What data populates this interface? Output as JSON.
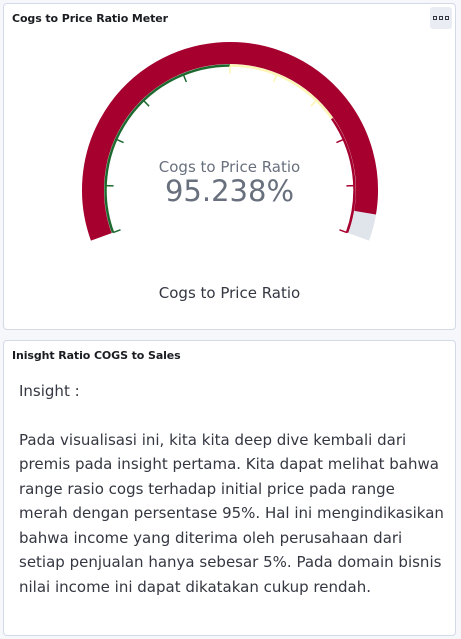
{
  "gauge_panel": {
    "title": "Cogs to Price Ratio Meter",
    "metric_label": "Cogs to Price Ratio",
    "metric_value": "95.238%",
    "caption": "Cogs to Price Ratio",
    "value_percent": 95.238,
    "colors": {
      "fill": "#a6002f",
      "track": "#e0e4eb",
      "green_band": "#1d6a2f",
      "yellow_band": "#fdf5b3",
      "red_band": "#a6002f"
    }
  },
  "insight_panel": {
    "title": "Inisght Ratio COGS to Sales",
    "heading": "Insight :",
    "paragraph": "Pada visualisasi ini, kita kita deep dive kembali dari premis pada insight pertama. Kita dapat melihat bahwa range rasio cogs terhadap initial price pada range merah dengan persentase 95%. Hal ini mengindikasikan bahwa income yang diterima oleh perusahaan dari setiap penjualan hanya sebesar 5%. Pada domain bisnis nilai income ini dapat dikatakan cukup rendah."
  }
}
